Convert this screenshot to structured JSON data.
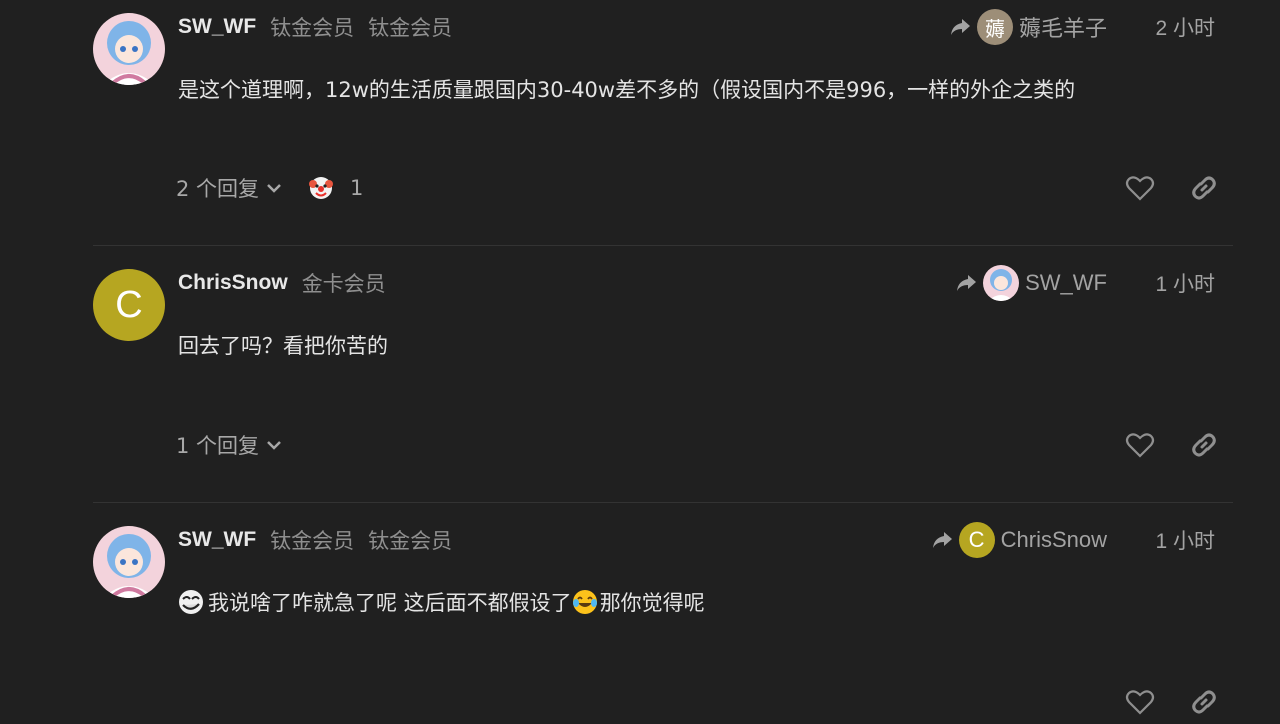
{
  "posts": [
    {
      "username": "SW_WF",
      "titles": [
        "钛金会员",
        "钛金会员"
      ],
      "reply_to": {
        "avatar_letter": "薅",
        "name": "薅毛羊子"
      },
      "time": "2 小时",
      "content": "是这个道理啊，12w的生活质量跟国内30-40w差不多的（假设国内不是996，一样的外企之类的",
      "replies": "2 个回复",
      "reaction": {
        "emoji": "clown-face",
        "count": "1"
      }
    },
    {
      "username": "ChrisSnow",
      "avatar_letter": "C",
      "titles": [
        "金卡会员"
      ],
      "reply_to": {
        "avatar": "SW_WF-avatar",
        "name": "SW_WF"
      },
      "time": "1 小时",
      "content": "回去了吗？看把你苦的",
      "replies": "1 个回复"
    },
    {
      "username": "SW_WF",
      "titles": [
        "钛金会员",
        "钛金会员"
      ],
      "reply_to": {
        "avatar_letter": "C",
        "name": "ChrisSnow"
      },
      "time": "1 小时",
      "content_parts": [
        "我说啥了咋就急了呢 这后面不都假设了 ",
        "那你觉得呢"
      ],
      "emojis": [
        "troll-face",
        "tears-of-joy"
      ]
    }
  ],
  "colors": {
    "background": "#202020",
    "gold_avatar": "#b6a621",
    "muted": "#a3a3a3"
  }
}
